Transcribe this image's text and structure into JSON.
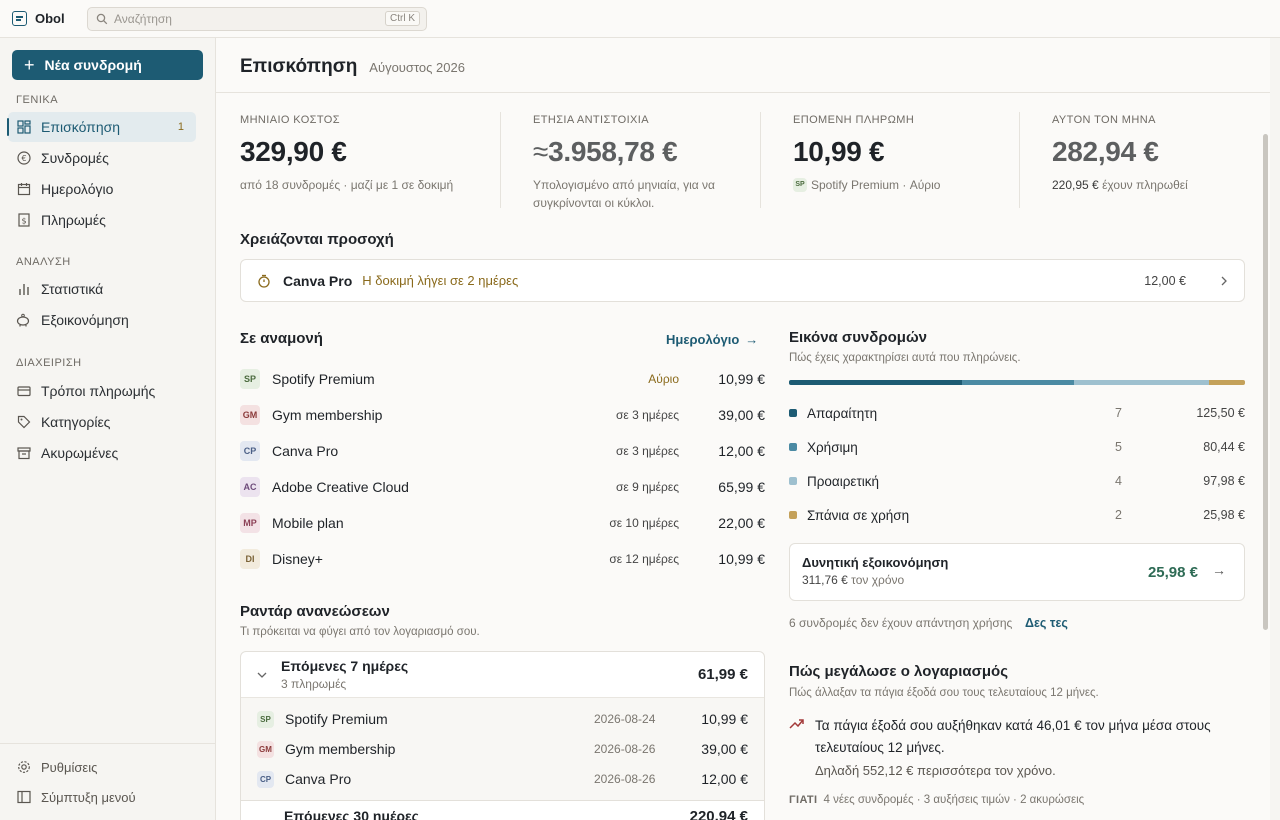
{
  "app": {
    "name": "Obol"
  },
  "search": {
    "placeholder": "Αναζήτηση",
    "shortcut": "Ctrl K"
  },
  "sidebar": {
    "new_button": "Νέα συνδρομή",
    "sections": [
      "ΓΕΝΙΚΑ",
      "ΑΝΑΛΥΣΗ",
      "ΔΙΑΧΕΙΡΙΣΗ"
    ],
    "items": [
      {
        "label": "Επισκόπηση",
        "badge": "1"
      },
      {
        "label": "Συνδρομές"
      },
      {
        "label": "Ημερολόγιο"
      },
      {
        "label": "Πληρωμές"
      },
      {
        "label": "Στατιστικά"
      },
      {
        "label": "Εξοικονόμηση"
      },
      {
        "label": "Τρόποι πληρωμής"
      },
      {
        "label": "Κατηγορίες"
      },
      {
        "label": "Ακυρωμένες"
      }
    ],
    "footer": {
      "settings": "Ρυθμίσεις",
      "collapse": "Σύμπτυξη μενού"
    }
  },
  "header": {
    "title": "Επισκόπηση",
    "period": "Αύγουστος 2026"
  },
  "kpis": [
    {
      "label": "ΜΗΝΙΑΙΟ ΚΟΣΤΟΣ",
      "value": "329,90 €",
      "note": "από 18 συνδρομές · μαζί με 1 σε δοκιμή"
    },
    {
      "label": "ΕΤΗΣΙΑ ΑΝΤΙΣΤΟΙΧΙΑ",
      "prefix": "≈",
      "value": "3.958,78 €",
      "note": "Υπολογισμένο από μηνιαία, για να συγκρίνονται οι κύκλοι."
    },
    {
      "label": "ΕΠΟΜΕΝΗ ΠΛΗΡΩΜΗ",
      "value": "10,99 €",
      "avatar": "SP",
      "note": "Spotify Premium · Αύριο"
    },
    {
      "label": "ΑΥΤΟΝ ΤΟΝ ΜΗΝΑ",
      "value": "282,94 €",
      "note_strong": "220,95 €",
      "note": "έχουν πληρωθεί"
    }
  ],
  "attention": {
    "title": "Χρειάζονται προσοχή",
    "item": {
      "name": "Canva Pro",
      "message": "Η δοκιμή λήγει σε 2 ημέρες",
      "amount": "12,00 €"
    }
  },
  "upcoming": {
    "title": "Σε αναμονή",
    "link": "Ημερολόγιο",
    "rows": [
      {
        "abbr": "SP",
        "name": "Spotify Premium",
        "when": "Αύριο",
        "amount": "10,99 €",
        "color": "#e6efe2",
        "fg": "#4b6b3e"
      },
      {
        "abbr": "GM",
        "name": "Gym membership",
        "when": "σε 3 ημέρες",
        "amount": "39,00 €",
        "color": "#f4e1e1",
        "fg": "#8c3b3b"
      },
      {
        "abbr": "CP",
        "name": "Canva Pro",
        "when": "σε 3 ημέρες",
        "amount": "12,00 €",
        "color": "#e3e8f1",
        "fg": "#4a5f86"
      },
      {
        "abbr": "AC",
        "name": "Adobe Creative Cloud",
        "when": "σε 9 ημέρες",
        "amount": "65,99 €",
        "color": "#ece3ef",
        "fg": "#6e4b7a"
      },
      {
        "abbr": "MP",
        "name": "Mobile plan",
        "when": "σε 10 ημέρες",
        "amount": "22,00 €",
        "color": "#f3e2e6",
        "fg": "#8c4056"
      },
      {
        "abbr": "DI",
        "name": "Disney+",
        "when": "σε 12 ημέρες",
        "amount": "10,99 €",
        "color": "#f2ebdd",
        "fg": "#7a6236"
      }
    ]
  },
  "radar": {
    "title": "Ραντάρ ανανεώσεων",
    "subtitle": "Τι πρόκειται να φύγει από τον λογαριασμό σου.",
    "group1": {
      "title": "Επόμενες 7 ημέρες",
      "count": "3 πληρωμές",
      "total": "61,99 €",
      "rows": [
        {
          "abbr": "SP",
          "name": "Spotify Premium",
          "date": "2026-08-24",
          "amount": "10,99 €"
        },
        {
          "abbr": "GM",
          "name": "Gym membership",
          "date": "2026-08-26",
          "amount": "39,00 €"
        },
        {
          "abbr": "CP",
          "name": "Canva Pro",
          "date": "2026-08-26",
          "amount": "12,00 €"
        }
      ]
    },
    "group2": {
      "title": "Επόμενες 30 ημέρες",
      "total": "220,94 €"
    }
  },
  "portfolio": {
    "title": "Εικόνα συνδρομών",
    "subtitle": "Πώς έχεις χαρακτηρίσει αυτά που πληρώνεις.",
    "categories": [
      {
        "name": "Απαραίτητη",
        "count": "7",
        "amount": "125,50 €",
        "share": 0.38,
        "color": "#1d5b73"
      },
      {
        "name": "Χρήσιμη",
        "count": "5",
        "amount": "80,44 €",
        "share": 0.245,
        "color": "#4b8aa3"
      },
      {
        "name": "Προαιρετική",
        "count": "4",
        "amount": "97,98 €",
        "share": 0.297,
        "color": "#9ec0cf"
      },
      {
        "name": "Σπάνια σε χρήση",
        "count": "2",
        "amount": "25,98 €",
        "share": 0.078,
        "color": "#c4a15a"
      }
    ],
    "savings": {
      "title": "Δυνητική εξοικονόμηση",
      "sub_strong": "311,76 €",
      "sub": "τον χρόνο",
      "amount": "25,98 €"
    },
    "unused_note": "6 συνδρομές δεν έχουν απάντηση χρήσης",
    "unused_link": "Δες τες"
  },
  "growth": {
    "title": "Πώς μεγάλωσε ο λογαριασμός",
    "subtitle": "Πώς άλλαξαν τα πάγια έξοδά σου τους τελευταίους 12 μήνες.",
    "text": "Τα πάγια έξοδά σου αυξήθηκαν κατά 46,01 € τον μήνα μέσα στους τελευταίους 12 μήνες.",
    "note": "Δηλαδή 552,12 € περισσότερα τον χρόνο.",
    "why_label": "ΓΙΑΤΙ",
    "why_items": "4 νέες συνδρομές · 3 αυξήσεις τιμών · 2 ακυρώσεις"
  }
}
